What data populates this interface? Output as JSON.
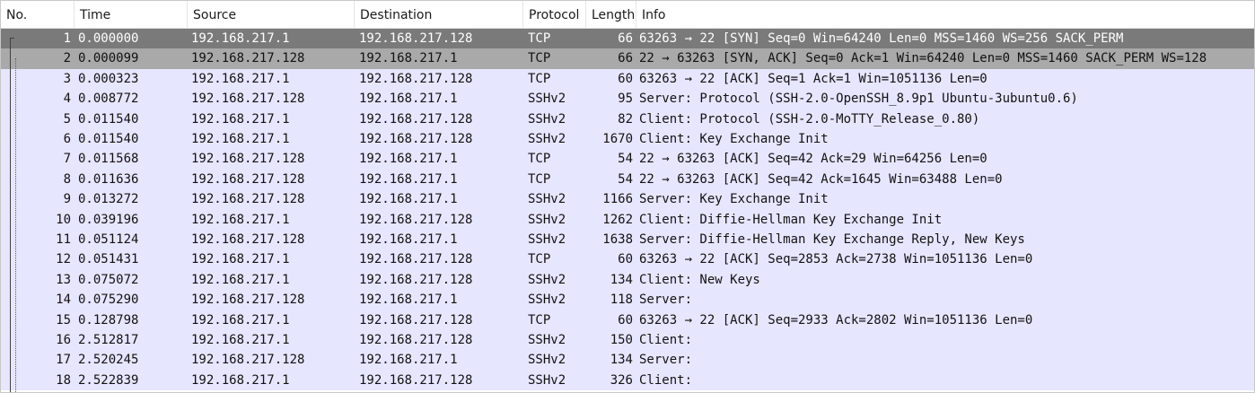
{
  "columns": {
    "no": "No.",
    "time": "Time",
    "source": "Source",
    "destination": "Destination",
    "protocol": "Protocol",
    "length": "Length",
    "info": "Info"
  },
  "colors": {
    "row_default": "#e7e6ff",
    "row_selected": "#7a7a7a",
    "row_related": "#a9a9a9"
  },
  "selected_packet": 1,
  "packets": [
    {
      "no": "1",
      "time": "0.000000",
      "source": "192.168.217.1",
      "destination": "192.168.217.128",
      "protocol": "TCP",
      "length": "66",
      "info": "63263 → 22 [SYN] Seq=0 Win=64240 Len=0 MSS=1460 WS=256 SACK_PERM"
    },
    {
      "no": "2",
      "time": "0.000099",
      "source": "192.168.217.128",
      "destination": "192.168.217.1",
      "protocol": "TCP",
      "length": "66",
      "info": "22 → 63263 [SYN, ACK] Seq=0 Ack=1 Win=64240 Len=0 MSS=1460 SACK_PERM WS=128"
    },
    {
      "no": "3",
      "time": "0.000323",
      "source": "192.168.217.1",
      "destination": "192.168.217.128",
      "protocol": "TCP",
      "length": "60",
      "info": "63263 → 22 [ACK] Seq=1 Ack=1 Win=1051136 Len=0"
    },
    {
      "no": "4",
      "time": "0.008772",
      "source": "192.168.217.128",
      "destination": "192.168.217.1",
      "protocol": "SSHv2",
      "length": "95",
      "info": "Server: Protocol (SSH-2.0-OpenSSH_8.9p1 Ubuntu-3ubuntu0.6)"
    },
    {
      "no": "5",
      "time": "0.011540",
      "source": "192.168.217.1",
      "destination": "192.168.217.128",
      "protocol": "SSHv2",
      "length": "82",
      "info": "Client: Protocol (SSH-2.0-MoTTY_Release_0.80)"
    },
    {
      "no": "6",
      "time": "0.011540",
      "source": "192.168.217.1",
      "destination": "192.168.217.128",
      "protocol": "SSHv2",
      "length": "1670",
      "info": "Client: Key Exchange Init"
    },
    {
      "no": "7",
      "time": "0.011568",
      "source": "192.168.217.128",
      "destination": "192.168.217.1",
      "protocol": "TCP",
      "length": "54",
      "info": "22 → 63263 [ACK] Seq=42 Ack=29 Win=64256 Len=0"
    },
    {
      "no": "8",
      "time": "0.011636",
      "source": "192.168.217.128",
      "destination": "192.168.217.1",
      "protocol": "TCP",
      "length": "54",
      "info": "22 → 63263 [ACK] Seq=42 Ack=1645 Win=63488 Len=0"
    },
    {
      "no": "9",
      "time": "0.013272",
      "source": "192.168.217.128",
      "destination": "192.168.217.1",
      "protocol": "SSHv2",
      "length": "1166",
      "info": "Server: Key Exchange Init"
    },
    {
      "no": "10",
      "time": "0.039196",
      "source": "192.168.217.1",
      "destination": "192.168.217.128",
      "protocol": "SSHv2",
      "length": "1262",
      "info": "Client: Diffie-Hellman Key Exchange Init"
    },
    {
      "no": "11",
      "time": "0.051124",
      "source": "192.168.217.128",
      "destination": "192.168.217.1",
      "protocol": "SSHv2",
      "length": "1638",
      "info": "Server: Diffie-Hellman Key Exchange Reply, New Keys"
    },
    {
      "no": "12",
      "time": "0.051431",
      "source": "192.168.217.1",
      "destination": "192.168.217.128",
      "protocol": "TCP",
      "length": "60",
      "info": "63263 → 22 [ACK] Seq=2853 Ack=2738 Win=1051136 Len=0"
    },
    {
      "no": "13",
      "time": "0.075072",
      "source": "192.168.217.1",
      "destination": "192.168.217.128",
      "protocol": "SSHv2",
      "length": "134",
      "info": "Client: New Keys"
    },
    {
      "no": "14",
      "time": "0.075290",
      "source": "192.168.217.128",
      "destination": "192.168.217.1",
      "protocol": "SSHv2",
      "length": "118",
      "info": "Server:"
    },
    {
      "no": "15",
      "time": "0.128798",
      "source": "192.168.217.1",
      "destination": "192.168.217.128",
      "protocol": "TCP",
      "length": "60",
      "info": "63263 → 22 [ACK] Seq=2933 Ack=2802 Win=1051136 Len=0"
    },
    {
      "no": "16",
      "time": "2.512817",
      "source": "192.168.217.1",
      "destination": "192.168.217.128",
      "protocol": "SSHv2",
      "length": "150",
      "info": "Client:"
    },
    {
      "no": "17",
      "time": "2.520245",
      "source": "192.168.217.128",
      "destination": "192.168.217.1",
      "protocol": "SSHv2",
      "length": "134",
      "info": "Server:"
    },
    {
      "no": "18",
      "time": "2.522839",
      "source": "192.168.217.1",
      "destination": "192.168.217.128",
      "protocol": "SSHv2",
      "length": "326",
      "info": "Client:"
    }
  ]
}
